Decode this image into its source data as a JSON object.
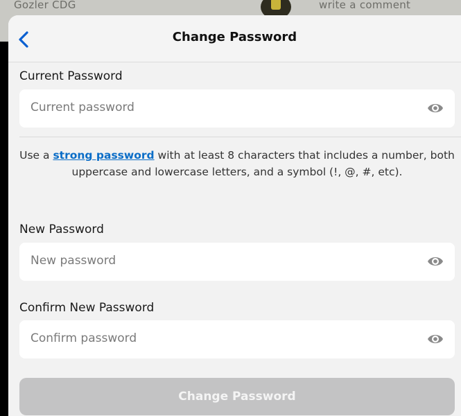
{
  "background": {
    "ghost_text_left": "Gozler CDG",
    "ghost_text_right": "write a comment"
  },
  "header": {
    "title": "Change Password"
  },
  "current_password": {
    "label": "Current Password",
    "placeholder": "Current password"
  },
  "help": {
    "prefix": "Use a ",
    "link_text": "strong password",
    "suffix": " with at least 8 characters that includes a number, both uppercase and lowercase letters, and a symbol (!, @, #, etc)."
  },
  "new_password": {
    "label": "New Password",
    "placeholder": "New password"
  },
  "confirm_password": {
    "label": "Confirm New Password",
    "placeholder": "Confirm password"
  },
  "submit": {
    "label": "Change Password",
    "state": "disabled"
  },
  "colors": {
    "accent_link": "#0b6dc7",
    "back_chevron": "#0a5fd1",
    "disabled_button": "#c3c3c4"
  },
  "icons": {
    "back": "chevron-left-icon",
    "visibility": "eye-icon"
  }
}
